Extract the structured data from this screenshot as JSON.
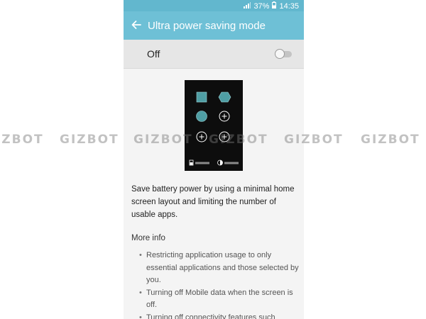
{
  "status_bar": {
    "battery": "37%",
    "time": "14:35"
  },
  "app_bar": {
    "title": "Ultra power saving mode"
  },
  "toggle": {
    "label": "Off",
    "on": false
  },
  "description": "Save battery power by using a minimal home screen layout and limiting the number of usable apps.",
  "more_info": {
    "heading": "More info",
    "items": [
      "Restricting application usage to only essential applications and those selected by you.",
      "Turning off Mobile data when the screen is off.",
      "Turning off connectivity features such"
    ]
  },
  "watermark": "GIZBOT",
  "colors": {
    "accent": "#6ec0d6",
    "status_bar": "#62b7ce",
    "preview_icon": "#4f9ea4"
  }
}
